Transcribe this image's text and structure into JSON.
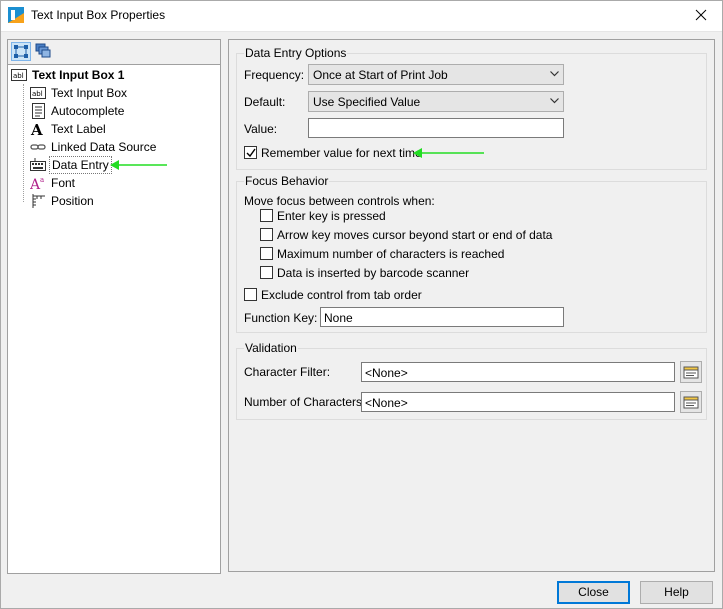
{
  "window": {
    "title": "Text Input Box Properties"
  },
  "tree": {
    "root": {
      "label": "Text Input Box 1",
      "icon": "abl-text-icon"
    },
    "items": [
      {
        "label": "Text Input Box",
        "icon": "abl-text-icon"
      },
      {
        "label": "Autocomplete",
        "icon": "autocomplete-icon"
      },
      {
        "label": "Text Label",
        "icon": "text-label-icon"
      },
      {
        "label": "Linked Data Source",
        "icon": "link-icon"
      },
      {
        "label": "Data Entry",
        "icon": "keyboard-icon",
        "selected": true
      },
      {
        "label": "Font",
        "icon": "font-icon"
      },
      {
        "label": "Position",
        "icon": "position-icon"
      }
    ]
  },
  "data_entry": {
    "title": "Data Entry Options",
    "frequency_label": "Frequency:",
    "frequency_value": "Once at Start of Print Job",
    "default_label": "Default:",
    "default_value": "Use Specified Value",
    "value_label": "Value:",
    "value_value": "",
    "remember_label": "Remember value for next time",
    "remember_checked": true
  },
  "focus": {
    "title": "Focus Behavior",
    "intro": "Move focus between controls when:",
    "options": [
      {
        "label": "Enter key is pressed",
        "checked": false
      },
      {
        "label": "Arrow key moves cursor beyond start or end of data",
        "checked": false
      },
      {
        "label": "Maximum number of characters is reached",
        "checked": false
      },
      {
        "label": "Data is inserted by barcode scanner",
        "checked": false
      }
    ],
    "exclude_label": "Exclude control from tab order",
    "function_key_label": "Function Key:",
    "function_key_value": "None"
  },
  "validation": {
    "title": "Validation",
    "char_filter_label": "Character Filter:",
    "char_filter_value": "<None>",
    "num_chars_label": "Number of Characters:",
    "num_chars_value": "<None>"
  },
  "buttons": {
    "close": "Close",
    "help": "Help"
  },
  "colors": {
    "accent": "#0078d7",
    "annotation_arrow": "#22dd22"
  }
}
